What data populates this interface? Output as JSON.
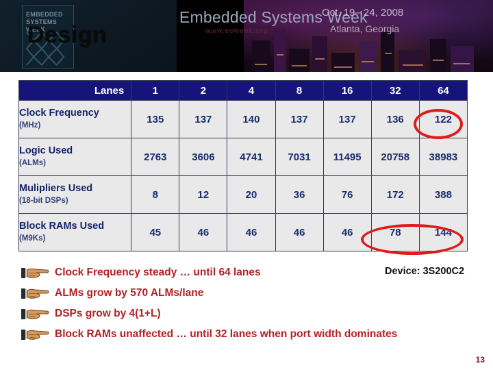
{
  "banner": {
    "logo_text": "EMBEDDED\nSYSTEMS\nWEEK",
    "title": "Embedded Systems Week",
    "url": "www.esweek.org",
    "date": "Oct. 19– 24, 2008",
    "place": "Atlanta, Georgia"
  },
  "slide": {
    "title": "Design",
    "device_label": "Device: 3S200C2",
    "page_number": "13"
  },
  "table": {
    "header": {
      "row_label": "Lanes",
      "columns": [
        "1",
        "2",
        "4",
        "8",
        "16",
        "32",
        "64"
      ]
    },
    "rows": [
      {
        "label": "Clock Frequency",
        "unit": "(MHz)",
        "values": [
          "135",
          "137",
          "140",
          "137",
          "137",
          "136",
          "122"
        ]
      },
      {
        "label": "Logic Used",
        "unit": "(ALMs)",
        "values": [
          "2763",
          "3606",
          "4741",
          "7031",
          "11495",
          "20758",
          "38983"
        ]
      },
      {
        "label": "Mulipliers Used",
        "unit": "(18-bit DSPs)",
        "values": [
          "8",
          "12",
          "20",
          "36",
          "76",
          "172",
          "388"
        ]
      },
      {
        "label": "Block RAMs Used",
        "unit": "(M9Ks)",
        "values": [
          "45",
          "46",
          "46",
          "46",
          "46",
          "78",
          "144"
        ]
      }
    ],
    "highlights": [
      {
        "name": "clock-frequency-64-lanes",
        "value": "122"
      },
      {
        "name": "block-rams-32-and-64-lanes",
        "value": "78, 144"
      }
    ]
  },
  "bullets": [
    "Clock Frequency steady … until 64 lanes",
    "ALMs grow by 570 ALMs/lane",
    "DSPs grow by 4(1+L)",
    "Block RAMs unaffected … until 32 lanes when port width dominates"
  ],
  "colors": {
    "header_blue": "#141479",
    "cell_gray": "#e9e9e9",
    "value_navy": "#1a2a6e",
    "bullet_red": "#b41f23",
    "highlight_red": "#e01b1b"
  }
}
